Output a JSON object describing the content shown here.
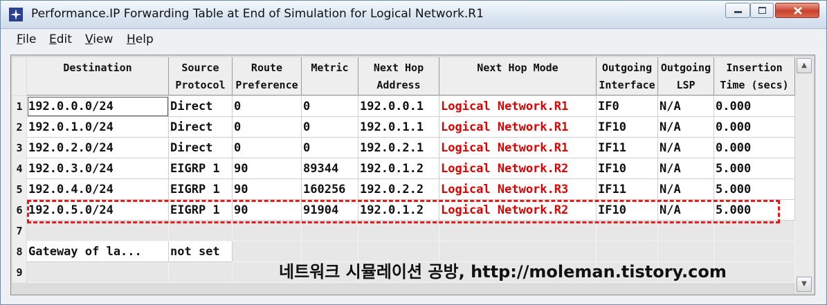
{
  "window": {
    "title": "Performance.IP Forwarding Table at End of Simulation for Logical Network.R1",
    "icon": "opnet-star-icon"
  },
  "menu": [
    {
      "label": "File",
      "mnemonic": "F",
      "rest": "ile"
    },
    {
      "label": "Edit",
      "mnemonic": "E",
      "rest": "dit"
    },
    {
      "label": "View",
      "mnemonic": "V",
      "rest": "iew"
    },
    {
      "label": "Help",
      "mnemonic": "H",
      "rest": "elp"
    }
  ],
  "table": {
    "columns": [
      "Destination",
      "Source\nProtocol",
      "Route\nPreference",
      "Metric",
      "Next Hop\nAddress",
      "Next Hop Mode",
      "Outgoing\nInterface",
      "Outgoing\nLSP",
      "Insertion\nTime (secs)"
    ],
    "rows": [
      {
        "num": "1",
        "cells": [
          "192.0.0.0/24",
          "Direct",
          "0",
          "0",
          "192.0.0.1",
          "Logical Network.R1",
          "IF0",
          "N/A",
          "0.000"
        ]
      },
      {
        "num": "2",
        "cells": [
          "192.0.1.0/24",
          "Direct",
          "0",
          "0",
          "192.0.1.1",
          "Logical Network.R1",
          "IF10",
          "N/A",
          "0.000"
        ]
      },
      {
        "num": "3",
        "cells": [
          "192.0.2.0/24",
          "Direct",
          "0",
          "0",
          "192.0.2.1",
          "Logical Network.R1",
          "IF11",
          "N/A",
          "0.000"
        ]
      },
      {
        "num": "4",
        "cells": [
          "192.0.3.0/24",
          "EIGRP 1",
          "90",
          "89344",
          "192.0.1.2",
          "Logical Network.R2",
          "IF10",
          "N/A",
          "5.000"
        ]
      },
      {
        "num": "5",
        "cells": [
          "192.0.4.0/24",
          "EIGRP 1",
          "90",
          "160256",
          "192.0.2.2",
          "Logical Network.R3",
          "IF11",
          "N/A",
          "5.000"
        ]
      },
      {
        "num": "6",
        "cells": [
          "192.0.5.0/24",
          "EIGRP 1",
          "90",
          "91904",
          "192.0.1.2",
          "Logical Network.R2",
          "IF10",
          "N/A",
          "5.000"
        ]
      },
      {
        "num": "7",
        "cells": [
          "",
          "",
          "",
          "",
          "",
          "",
          "",
          "",
          ""
        ]
      },
      {
        "num": "8",
        "cells": [
          "Gateway of la...",
          "not set",
          "",
          "",
          "",
          "",
          "",
          "",
          ""
        ]
      },
      {
        "num": "9",
        "cells": [
          "",
          "",
          "",
          "",
          "",
          "",
          "",
          "",
          ""
        ]
      }
    ]
  },
  "highlight_color": "#e51b1b",
  "watermark": "네트워크 시뮬레이션 공방, http://moleman.tistory.com"
}
